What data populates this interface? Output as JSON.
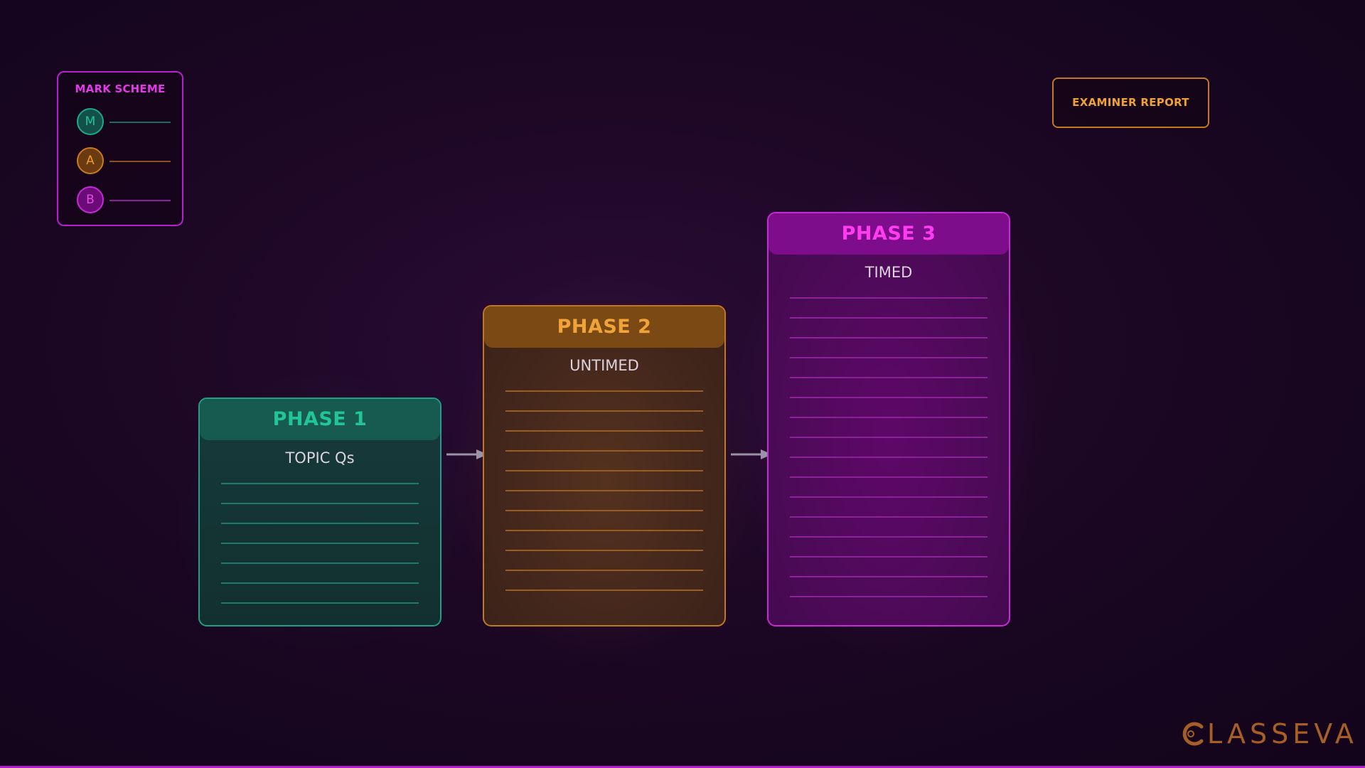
{
  "legend": {
    "title": "MARK SCHEME",
    "items": [
      {
        "letter": "M",
        "color": "#21c497"
      },
      {
        "letter": "A",
        "color": "#f09b24"
      },
      {
        "letter": "B",
        "color": "#e54de9"
      }
    ]
  },
  "examiner_button": {
    "label": "EXAMINER REPORT"
  },
  "phases": [
    {
      "title": "PHASE 1",
      "subtitle": "TOPIC Qs",
      "color": "#22c597",
      "line_count": 7
    },
    {
      "title": "PHASE 2",
      "subtitle": "UNTIMED",
      "color": "#f0a338",
      "line_count": 11
    },
    {
      "title": "PHASE 3",
      "subtitle": "TIMED",
      "color": "#ff3cf0",
      "line_count": 16
    }
  ],
  "logo": {
    "text": "LASSEVA",
    "color": "#a75f25"
  },
  "colors": {
    "teal": "#1e9f86",
    "amber": "#c17820",
    "pink": "#c72ad8",
    "arrow": "#9a92a6"
  }
}
